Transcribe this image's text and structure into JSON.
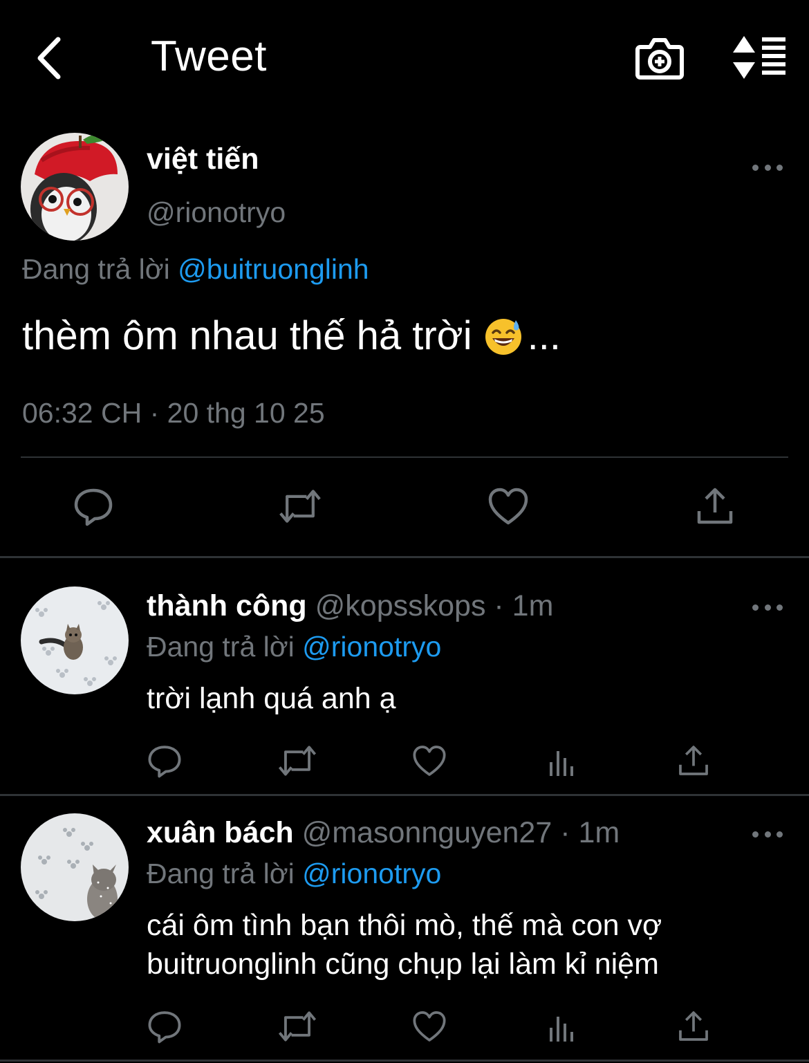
{
  "header": {
    "title": "Tweet",
    "back_icon": "chevron-left-icon",
    "camera_icon": "camera-plus-icon",
    "sort_icon": "sort-list-icon"
  },
  "main_tweet": {
    "name": "việt tiến",
    "handle": "@rionotryo",
    "replying_prefix": "Đang trả lời",
    "replying_to": "@buitruonglinh",
    "text": "thèm ôm nhau thế hả trời",
    "text_suffix": "...",
    "emoji": "grinning-face-with-sweat",
    "timestamp": "06:32 CH · 20 thg 10 25"
  },
  "replies": [
    {
      "name": "thành công",
      "meta": "@kopsskops · 1m",
      "replying_prefix": "Đang trả lời",
      "replying_to": "@rionotryo",
      "text": "trời lạnh quá anh ạ"
    },
    {
      "name": "xuân bách",
      "meta": "@masonnguyen27 · 1m",
      "replying_prefix": "Đang trả lời",
      "replying_to": "@rionotryo",
      "text": "cái ôm tình bạn thôi mò, thế mà con vợ\nbuitruonglinh cũng chụp lại làm kỉ niệm"
    }
  ],
  "colors": {
    "background": "#000000",
    "text": "#ffffff",
    "secondary": "#71767b",
    "accent": "#1d9bf0",
    "divider": "#2f3336"
  }
}
